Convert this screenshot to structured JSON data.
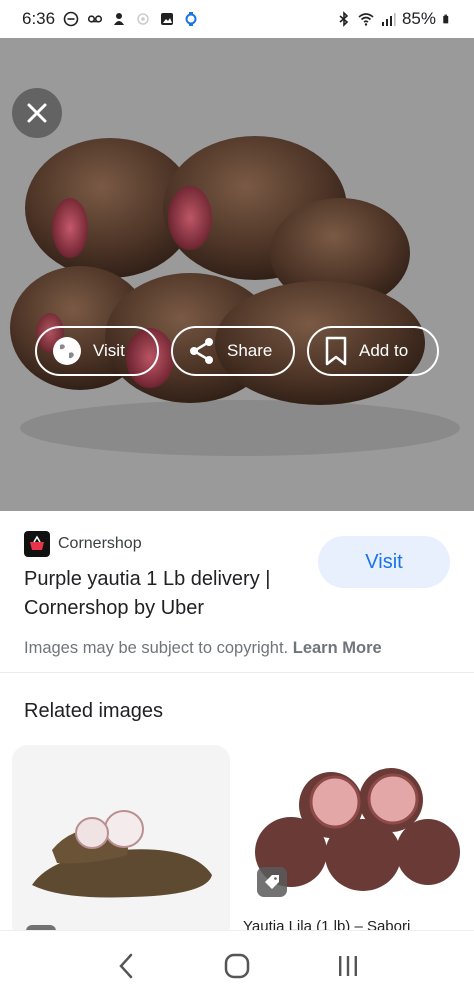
{
  "status_bar": {
    "time": "6:36",
    "battery": "85%",
    "icons": [
      "dnd-icon",
      "voicemail-icon",
      "notification-icon",
      "location-icon",
      "gallery-icon",
      "watch-icon",
      "bluetooth-icon",
      "wifi-icon",
      "signal-icon",
      "battery-icon"
    ]
  },
  "viewer": {
    "close_icon": "close-icon",
    "actions": [
      {
        "label": "Visit",
        "icon": "globe-icon"
      },
      {
        "label": "Share",
        "icon": "share-icon"
      },
      {
        "label": "Add to",
        "icon": "bookmark-icon"
      }
    ]
  },
  "result": {
    "source": "Cornershop",
    "title": "Purple yautia 1 Lb delivery | Cornershop by Uber",
    "visit_label": "Visit",
    "copyright_text": "Images may be subject to copyright.",
    "learn_more": "Learn More"
  },
  "related": {
    "heading": "Related images",
    "items": [
      {
        "label": ""
      },
      {
        "label": "Yautia Lila (1 lb) – Sabori"
      }
    ]
  },
  "colors": {
    "accent": "#1a73e8",
    "accent_bg": "#e8f0fe",
    "viewer_bg": "#9a9a9a"
  }
}
